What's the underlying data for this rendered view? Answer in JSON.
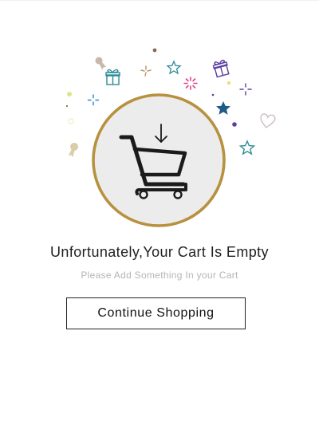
{
  "empty_cart": {
    "title": "Unfortunately,Your Cart Is Empty",
    "subtitle": "Please Add Something In your Cart",
    "continue_label": "Continue Shopping"
  },
  "icons": {
    "main": "shopping-cart-icon",
    "indicator": "arrow-down-icon",
    "decorations": [
      "gift-icon",
      "star-icon",
      "sparkle-icon",
      "heart-icon",
      "medal-icon",
      "dot-icon"
    ]
  },
  "colors": {
    "circle_border": "#b8913f",
    "circle_fill": "#ececec",
    "star_teal": "#2c8b96",
    "star_navy": "#1e5c86",
    "sparkle_pink": "#e8428c",
    "sparkle_purple": "#5b3ea4",
    "button_border": "#222222"
  }
}
